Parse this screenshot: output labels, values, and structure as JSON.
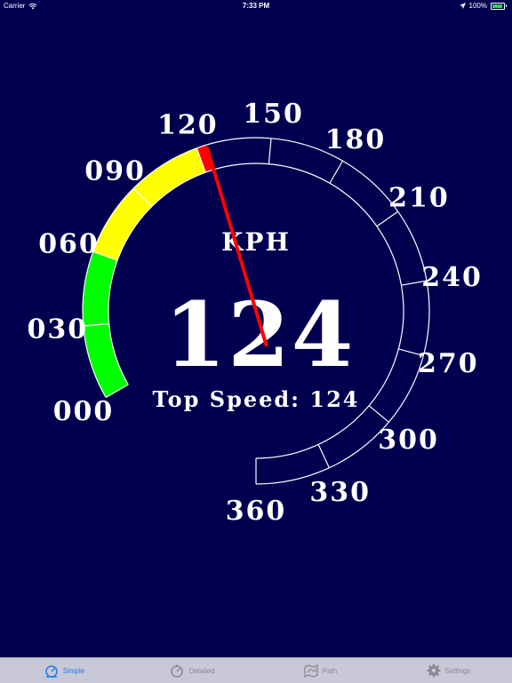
{
  "status": {
    "carrier": "Carrier",
    "time": "7:33 PM",
    "battery": "100%",
    "battery_level": 1.0
  },
  "gauge": {
    "unit": "KPH",
    "current_speed": "124",
    "current_speed_value": 124,
    "top_speed_label": "Top Speed:",
    "top_speed": "124",
    "min": 0,
    "max": 360,
    "labels": [
      "000",
      "030",
      "060",
      "090",
      "120",
      "150",
      "180",
      "210",
      "240",
      "270",
      "300",
      "330",
      "360"
    ],
    "color_bands": [
      {
        "from": 0,
        "to": 60,
        "color": "#00ff00"
      },
      {
        "from": 60,
        "to": 120,
        "color": "#ffff00"
      },
      {
        "from": 120,
        "to": 124,
        "color": "#ff0000"
      }
    ],
    "needle_color": "#ff0000"
  },
  "tabs": [
    {
      "label": "Simple",
      "icon": "gauge-icon",
      "active": true
    },
    {
      "label": "Detailed",
      "icon": "gauge-detailed-icon",
      "active": false
    },
    {
      "label": "Path",
      "icon": "map-icon",
      "active": false
    },
    {
      "label": "Settings",
      "icon": "gear-icon",
      "active": false
    }
  ]
}
